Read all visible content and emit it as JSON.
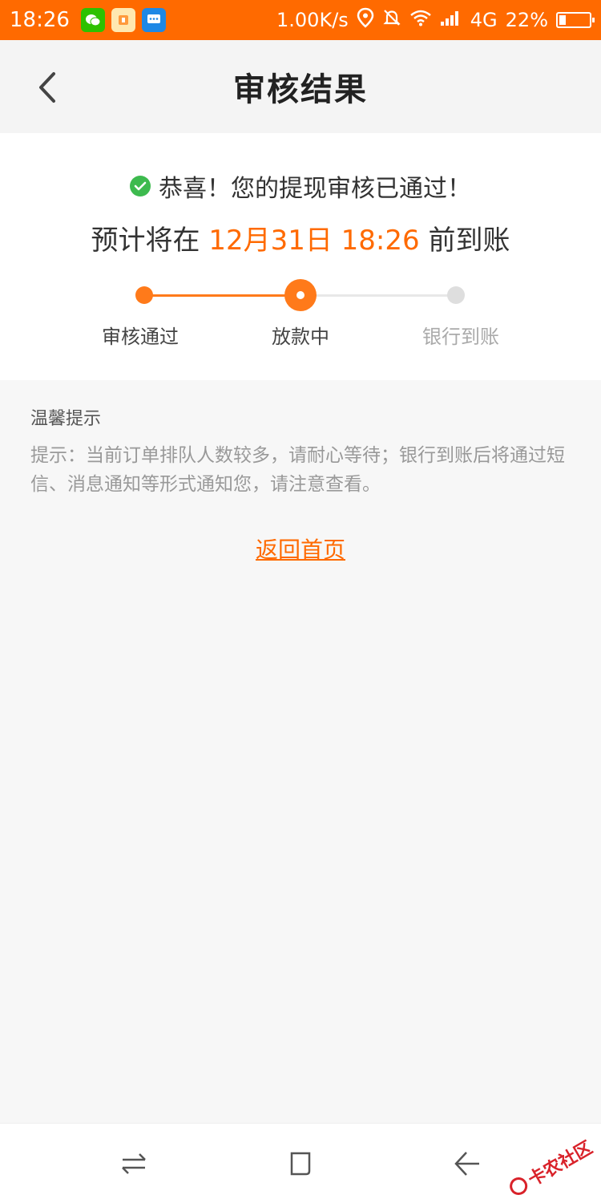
{
  "status_bar": {
    "time": "18:26",
    "apps": [
      "wechat-icon",
      "game-app-icon",
      "message-app-icon"
    ],
    "network_speed": "1.00K/s",
    "network_type": "4G",
    "battery_percent": "22%",
    "battery_level": 0.22
  },
  "header": {
    "title": "审核结果"
  },
  "result": {
    "success_message": "恭喜！您的提现审核已通过！",
    "eta_prefix": "预计将在",
    "eta_time": "12月31日 18:26",
    "eta_suffix": "前到账"
  },
  "steps": [
    {
      "label": "审核通过",
      "state": "done"
    },
    {
      "label": "放款中",
      "state": "current"
    },
    {
      "label": "银行到账",
      "state": "pending"
    }
  ],
  "tips": {
    "title": "温馨提示",
    "body": "提示：当前订单排队人数较多，请耐心等待；银行到账后将通过短信、消息通知等形式通知您，请注意查看。"
  },
  "actions": {
    "home_link": "返回首页"
  },
  "watermark": {
    "text": "卡农社区"
  },
  "colors": {
    "accent": "#ff6a00",
    "success": "#3dba4e",
    "pending": "#dedede"
  }
}
